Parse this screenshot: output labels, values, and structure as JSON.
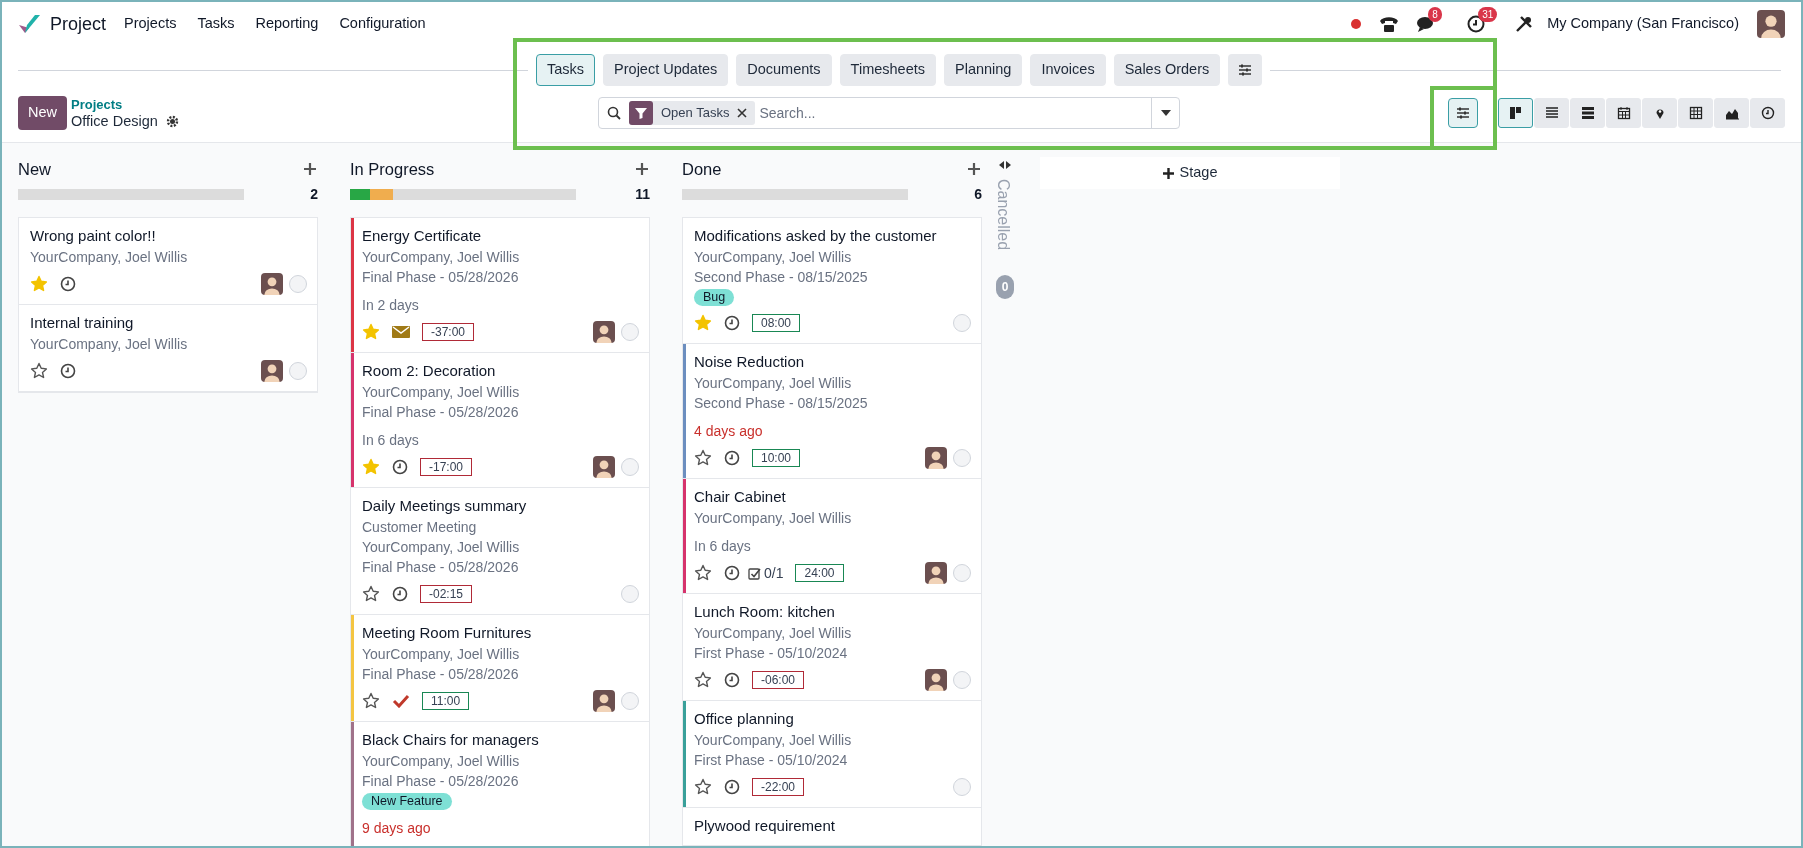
{
  "app": {
    "name": "Project",
    "menu": [
      "Projects",
      "Tasks",
      "Reporting",
      "Configuration"
    ]
  },
  "systray": {
    "chat_count": "8",
    "activity_count": "31",
    "company": "My Company (San Francisco)"
  },
  "breadcrumb": {
    "parent": "Projects",
    "current": "Office Design"
  },
  "new_button": "New",
  "tabs": [
    {
      "label": "Tasks",
      "selected": true
    },
    {
      "label": "Project Updates",
      "selected": false
    },
    {
      "label": "Documents",
      "selected": false
    },
    {
      "label": "Timesheets",
      "selected": false
    },
    {
      "label": "Planning",
      "selected": false
    },
    {
      "label": "Invoices",
      "selected": false
    },
    {
      "label": "Sales Orders",
      "selected": false
    }
  ],
  "search": {
    "facet": "Open Tasks",
    "placeholder": "Search..."
  },
  "views": [
    {
      "kind": "kanban",
      "selected": true
    },
    {
      "kind": "list",
      "selected": false
    },
    {
      "kind": "gantt",
      "selected": false
    },
    {
      "kind": "calendar",
      "selected": false
    },
    {
      "kind": "map",
      "selected": false
    },
    {
      "kind": "pivot",
      "selected": false
    },
    {
      "kind": "graph",
      "selected": false
    },
    {
      "kind": "activity",
      "selected": false
    }
  ],
  "columns": [
    {
      "title": "New",
      "count": "2",
      "cards": [
        {
          "title": "Wrong paint color!!",
          "lines": [
            "YourCompany, Joel Willis"
          ],
          "starred": true,
          "activity": {
            "kind": "clock"
          },
          "avatar": true
        },
        {
          "title": "Internal training",
          "lines": [
            "YourCompany, Joel Willis"
          ],
          "starred": false,
          "activity": {
            "kind": "clock"
          },
          "avatar": true
        }
      ]
    },
    {
      "title": "In Progress",
      "count": "11",
      "progress": {
        "segments": [
          {
            "color": "#28a745",
            "level": 0.09
          },
          {
            "color": "#f0ad4e",
            "level": 0.1
          }
        ]
      },
      "cards": [
        {
          "title": "Energy Certificate",
          "lines": [
            "YourCompany, Joel Willis",
            "Final Phase - 05/28/2026"
          ],
          "deadline": {
            "text": "In 2 days",
            "overdue": false
          },
          "starred": true,
          "activity": {
            "kind": "envelope"
          },
          "hours": {
            "text": "-37:00",
            "over": true
          },
          "avatar": true,
          "color": "#dc3545"
        },
        {
          "title": "Room 2: Decoration",
          "lines": [
            "YourCompany, Joel Willis",
            "Final Phase - 05/28/2026"
          ],
          "deadline": {
            "text": "In 6 days",
            "overdue": false
          },
          "starred": true,
          "activity": {
            "kind": "clock"
          },
          "hours": {
            "text": "-17:00",
            "over": true
          },
          "avatar": true,
          "color": "#d6336c"
        },
        {
          "title": "Daily Meetings summary",
          "lines": [
            "Customer Meeting",
            "YourCompany, Joel Willis",
            "Final Phase - 05/28/2026"
          ],
          "starred": false,
          "activity": {
            "kind": "clock"
          },
          "hours": {
            "text": "-02:15",
            "over": true
          }
        },
        {
          "title": "Meeting Room Furnitures",
          "lines": [
            "YourCompany, Joel Willis",
            "Final Phase - 05/28/2026"
          ],
          "starred": false,
          "activity": {
            "kind": "check"
          },
          "hours": {
            "text": "11:00",
            "over": false
          },
          "avatar": true,
          "color": "#f4c542"
        },
        {
          "title": "Black Chairs for managers",
          "lines": [
            "YourCompany, Joel Willis",
            "Final Phase - 05/28/2026"
          ],
          "tags": [
            {
              "label": "New Feature",
              "color": "#7ee0d5"
            }
          ],
          "deadline": {
            "text": "9 days ago",
            "overdue": true
          },
          "color": "#a0728a"
        }
      ]
    },
    {
      "title": "Done",
      "count": "6",
      "cards": [
        {
          "title": "Modifications asked by the customer",
          "lines": [
            "YourCompany, Joel Willis",
            "Second Phase - 08/15/2025"
          ],
          "tags": [
            {
              "label": "Bug",
              "color": "#7ee0d5"
            }
          ],
          "starred": true,
          "activity": {
            "kind": "clock"
          },
          "hours": {
            "text": "08:00",
            "over": false
          }
        },
        {
          "title": "Noise Reduction",
          "lines": [
            "YourCompany, Joel Willis",
            "Second Phase - 08/15/2025"
          ],
          "deadline": {
            "text": "4 days ago",
            "overdue": true
          },
          "starred": false,
          "activity": {
            "kind": "clock"
          },
          "hours": {
            "text": "10:00",
            "over": false
          },
          "avatar": true,
          "color": "#6c8ebf"
        },
        {
          "title": "Chair Cabinet",
          "lines": [
            "YourCompany, Joel Willis"
          ],
          "deadline": {
            "text": "In 6 days",
            "overdue": false
          },
          "starred": false,
          "activity": {
            "kind": "clock"
          },
          "subtasks": "0/1",
          "hours": {
            "text": "24:00",
            "over": false
          },
          "avatar": true,
          "color": "#d6336c"
        },
        {
          "title": "Lunch Room: kitchen",
          "lines": [
            "YourCompany, Joel Willis",
            "First Phase - 05/10/2024"
          ],
          "starred": false,
          "activity": {
            "kind": "clock"
          },
          "hours": {
            "text": "-06:00",
            "over": true
          },
          "avatar": true
        },
        {
          "title": "Office planning",
          "lines": [
            "YourCompany, Joel Willis",
            "First Phase - 05/10/2024"
          ],
          "starred": false,
          "activity": {
            "kind": "clock"
          },
          "hours": {
            "text": "-22:00",
            "over": true
          },
          "color": "#3aa09a"
        },
        {
          "title": "Plywood requirement"
        }
      ]
    }
  ],
  "folded_column": {
    "title": "Cancelled",
    "count": "0"
  },
  "add_stage": "Stage"
}
